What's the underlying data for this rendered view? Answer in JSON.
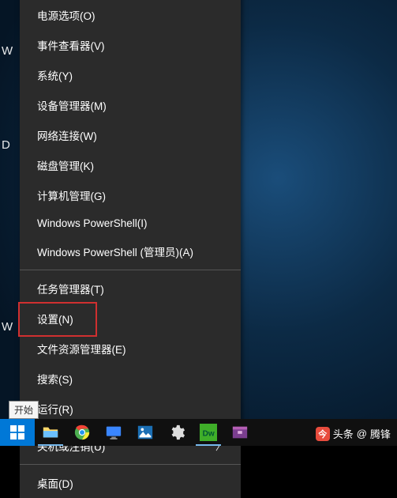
{
  "menu": {
    "items": [
      {
        "label": "电源选项(O)"
      },
      {
        "label": "事件查看器(V)"
      },
      {
        "label": "系统(Y)"
      },
      {
        "label": "设备管理器(M)"
      },
      {
        "label": "网络连接(W)"
      },
      {
        "label": "磁盘管理(K)"
      },
      {
        "label": "计算机管理(G)"
      },
      {
        "label": "Windows PowerShell(I)"
      },
      {
        "label": "Windows PowerShell (管理员)(A)"
      }
    ],
    "items2": [
      {
        "label": "任务管理器(T)"
      },
      {
        "label": "设置(N)",
        "highlighted": true
      },
      {
        "label": "文件资源管理器(E)"
      },
      {
        "label": "搜索(S)"
      },
      {
        "label": "运行(R)"
      }
    ],
    "items3": [
      {
        "label": "关机或注销(U)",
        "submenu": true
      }
    ],
    "items4": [
      {
        "label": "桌面(D)"
      }
    ]
  },
  "start_tooltip": "开始",
  "left_hints": [
    "W",
    "",
    "D",
    "",
    "",
    "W"
  ],
  "taskbar_icons": [
    "start",
    "file-explorer",
    "chrome",
    "display-settings",
    "photos",
    "settings-gear",
    "dreamweaver",
    "archive"
  ],
  "credit": {
    "prefix": "头条",
    "at": "@",
    "author": "腾锋"
  }
}
